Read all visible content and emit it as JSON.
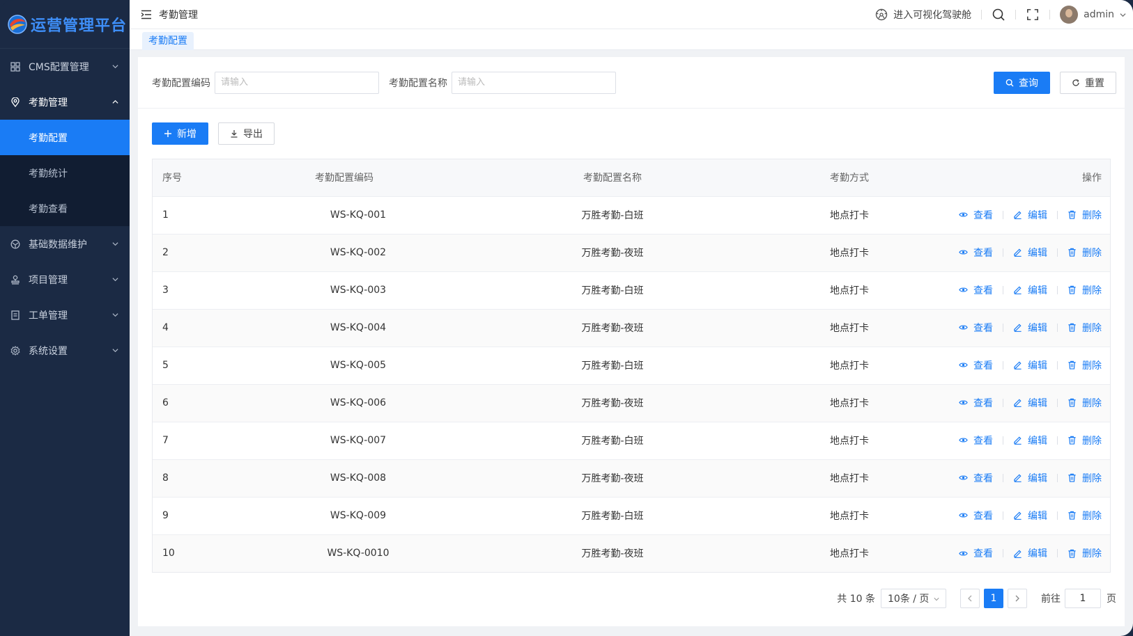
{
  "app": {
    "logo_text": "运营管理平台"
  },
  "sidebar": {
    "items": [
      {
        "label": "CMS配置管理",
        "icon": "grid-icon",
        "open": false
      },
      {
        "label": "考勤管理",
        "icon": "location-icon",
        "open": true,
        "children": [
          {
            "label": "考勤配置",
            "active": true
          },
          {
            "label": "考勤统计",
            "active": false
          },
          {
            "label": "考勤查看",
            "active": false
          }
        ]
      },
      {
        "label": "基础数据维护",
        "icon": "database-icon",
        "open": false
      },
      {
        "label": "项目管理",
        "icon": "stamp-icon",
        "open": false
      },
      {
        "label": "工单管理",
        "icon": "document-icon",
        "open": false
      },
      {
        "label": "系统设置",
        "icon": "gear-icon",
        "open": false
      }
    ]
  },
  "header": {
    "breadcrumb": "考勤管理",
    "cockpit_link": "进入可视化驾驶舱",
    "user": "admin"
  },
  "tabs": {
    "active": "考勤配置"
  },
  "search": {
    "code_label": "考勤配置编码",
    "code_placeholder": "请输入",
    "name_label": "考勤配置名称",
    "name_placeholder": "请输入",
    "query_label": "查询",
    "reset_label": "重置"
  },
  "toolbar": {
    "add_label": "新增",
    "export_label": "导出"
  },
  "table": {
    "columns": [
      "序号",
      "考勤配置编码",
      "考勤配置名称",
      "考勤方式",
      "操作"
    ],
    "actions": [
      "查看",
      "编辑",
      "删除"
    ],
    "rows": [
      [
        "1",
        "WS-KQ-001",
        "万胜考勤-白班",
        "地点打卡"
      ],
      [
        "2",
        "WS-KQ-002",
        "万胜考勤-夜班",
        "地点打卡"
      ],
      [
        "3",
        "WS-KQ-003",
        "万胜考勤-白班",
        "地点打卡"
      ],
      [
        "4",
        "WS-KQ-004",
        "万胜考勤-夜班",
        "地点打卡"
      ],
      [
        "5",
        "WS-KQ-005",
        "万胜考勤-白班",
        "地点打卡"
      ],
      [
        "6",
        "WS-KQ-006",
        "万胜考勤-夜班",
        "地点打卡"
      ],
      [
        "7",
        "WS-KQ-007",
        "万胜考勤-白班",
        "地点打卡"
      ],
      [
        "8",
        "WS-KQ-008",
        "万胜考勤-夜班",
        "地点打卡"
      ],
      [
        "9",
        "WS-KQ-009",
        "万胜考勤-白班",
        "地点打卡"
      ],
      [
        "10",
        "WS-KQ-0010",
        "万胜考勤-夜班",
        "地点打卡"
      ]
    ]
  },
  "pagination": {
    "total_text": "共 10 条",
    "page_size": "10条 / 页",
    "current_page": "1",
    "goto_label": "前往",
    "goto_value": "1",
    "page_unit": "页"
  },
  "colors": {
    "primary": "#1a7cf5",
    "sidebar_bg": "#1b2a44",
    "submenu_bg": "#111d32"
  }
}
